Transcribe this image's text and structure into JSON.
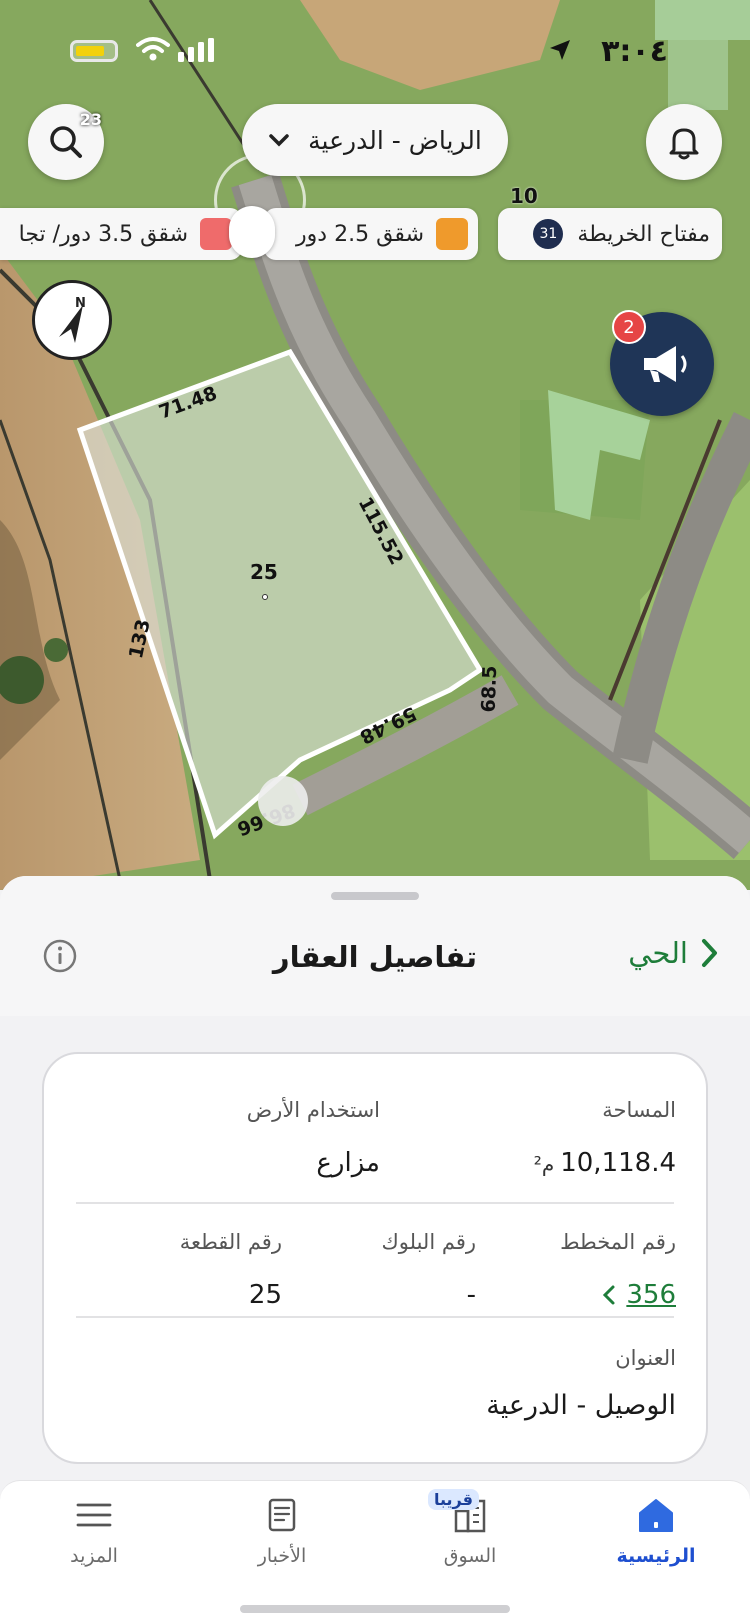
{
  "status_bar": {
    "time": "٣:٠٤"
  },
  "header": {
    "search_badge": "23",
    "region": "الرياض - الدرعية"
  },
  "legend": {
    "map_key_label": "مفتاح الخريطة",
    "map_key_count": "31",
    "map_key_number": "10",
    "chips": [
      {
        "label": "شقق 2.5 دور",
        "color": "#ef9a2c"
      },
      {
        "label": "شقق 3.5 دور/ تجا",
        "color": "#ef6b6b"
      }
    ]
  },
  "announcements": {
    "badge": "2"
  },
  "map": {
    "compass_letter": "N",
    "parcel_number": "25",
    "dimensions": [
      "71.48",
      "115.52",
      "133",
      "59.48",
      "68.5",
      "86.66"
    ]
  },
  "sheet": {
    "title": "تفاصيل العقار",
    "district_link": "الحي",
    "fields": {
      "area_label": "المساحة",
      "area_value": "10,118.4",
      "area_unit": "م²",
      "land_use_label": "استخدام الأرض",
      "land_use_value": "مزارع",
      "plan_label": "رقم المخطط",
      "plan_value": "356",
      "block_label": "رقم البلوك",
      "block_value": "-",
      "parcel_label": "رقم القطعة",
      "parcel_value": "25",
      "address_label": "العنوان",
      "address_value": "الوصيل - الدرعية"
    }
  },
  "tabs": [
    {
      "label": "الرئيسية",
      "icon": "home-icon",
      "active": true
    },
    {
      "label": "السوق",
      "icon": "buildings-icon",
      "badge": "قريبا"
    },
    {
      "label": "الأخبار",
      "icon": "news-icon"
    },
    {
      "label": "المزيد",
      "icon": "menu-icon"
    }
  ],
  "colors": {
    "accent_green": "#1e7d3a",
    "active_tab": "#1e4fd0",
    "navy": "#1f3557"
  }
}
